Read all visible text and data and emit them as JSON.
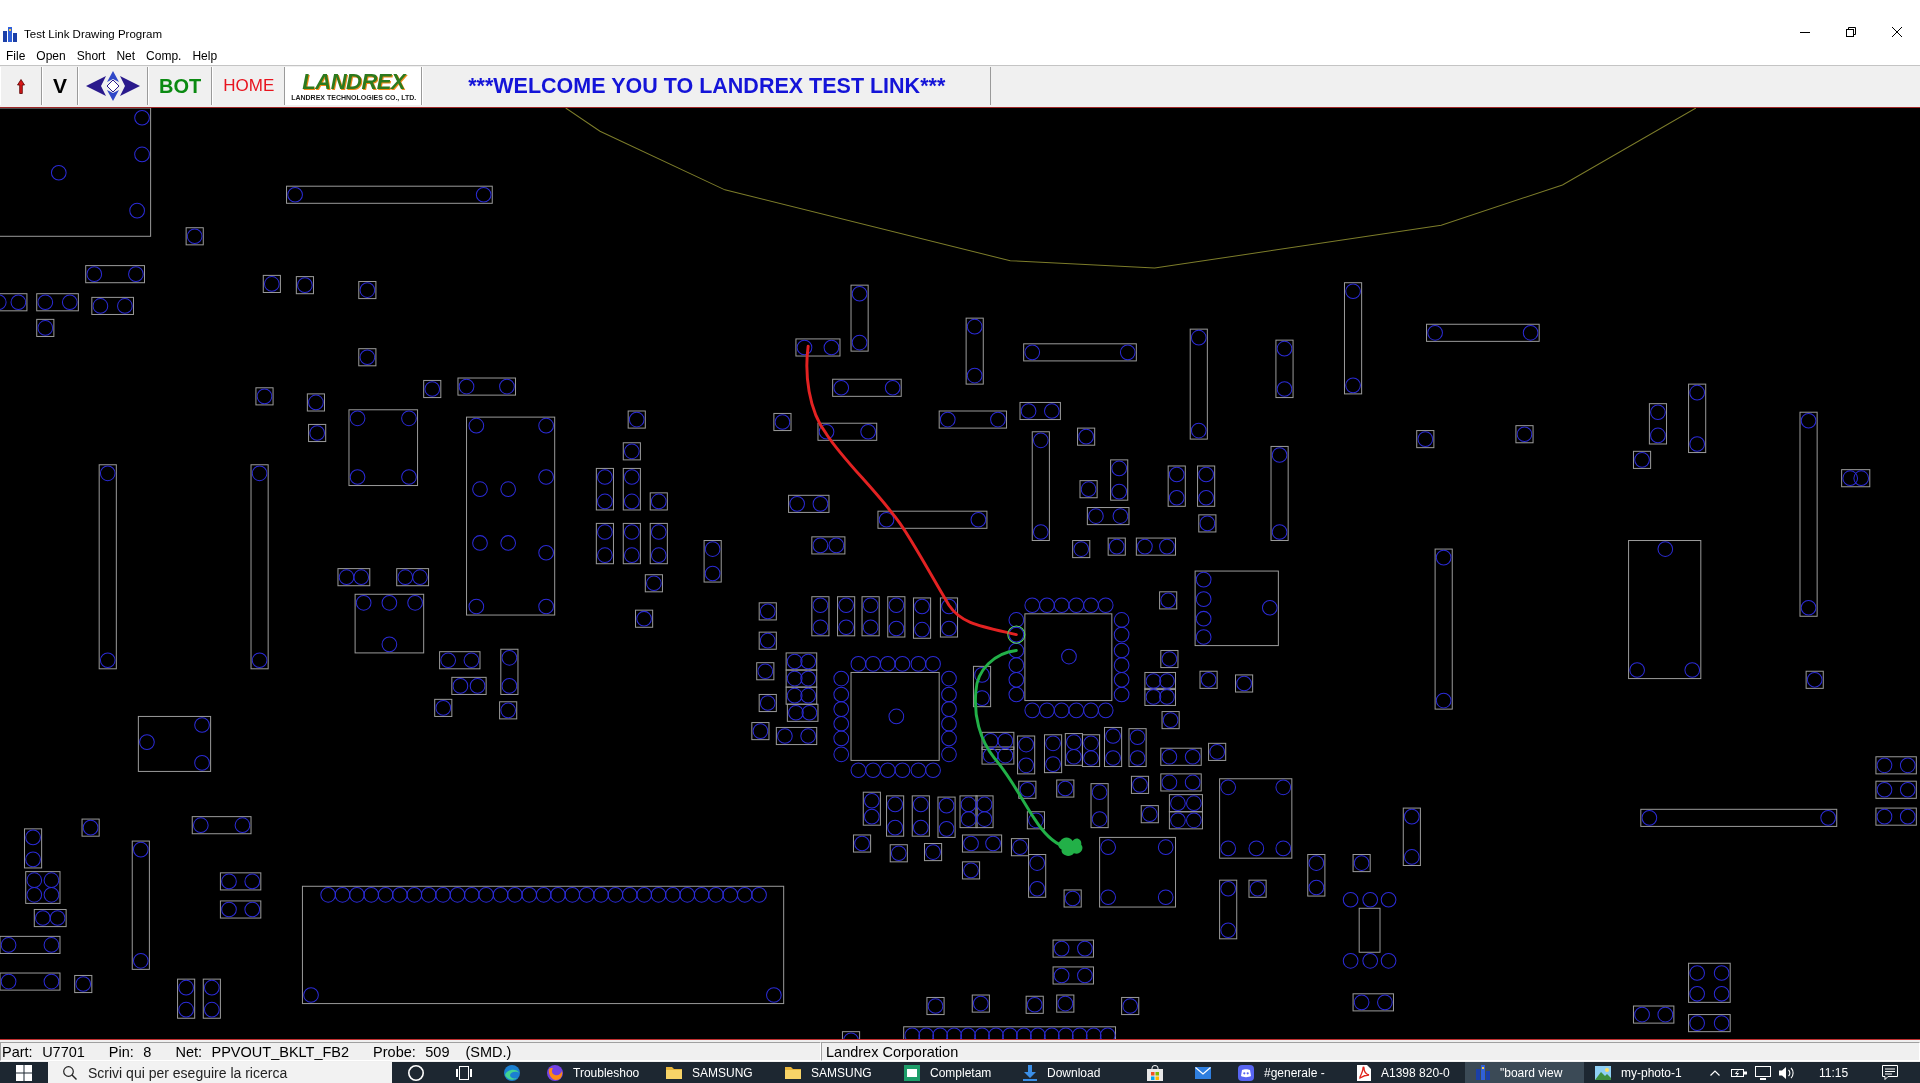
{
  "window": {
    "title": "Test Link Drawing Program"
  },
  "menu": [
    "File",
    "Open",
    "Short",
    "Net",
    "Comp.",
    "Help"
  ],
  "toolbar": {
    "buttons": [
      {
        "kind": "up-arrow"
      },
      {
        "kind": "text",
        "label": "V",
        "color": "#000000"
      },
      {
        "kind": "pan-arrows"
      },
      {
        "kind": "text",
        "label": "BOT",
        "color": "#0b8a12"
      },
      {
        "kind": "text",
        "label": "HOME",
        "color": "#e8141e"
      }
    ],
    "logo": {
      "wordmark": "LANDREX",
      "tagline": "LANDREX TECHNOLOGIES CO., LTD."
    },
    "banner": "***WELCOME YOU TO LANDREX TEST LINK***"
  },
  "status_bar": {
    "fields": [
      {
        "label": "Part:",
        "value": "U7701"
      },
      {
        "label": "Pin:",
        "value": "8"
      },
      {
        "label": "Net:",
        "value": "PPVOUT_BKLT_FB2"
      },
      {
        "label": "Probe:",
        "value": "509"
      }
    ],
    "package": "(SMD.)",
    "company": "Landrex Corporation"
  },
  "taskbar": {
    "search": {
      "placeholder": "Scrivi qui per eseguire la ricerca"
    },
    "items": [
      {
        "kind": "ring",
        "selected": false
      },
      {
        "kind": "task-view",
        "selected": false
      },
      {
        "kind": "swirl",
        "selected": false
      },
      {
        "kind": "globe",
        "label": "Troubleshoo",
        "selected": false
      },
      {
        "kind": "folder",
        "label": "SAMSUNG",
        "selected": false
      },
      {
        "kind": "folder",
        "label": "SAMSUNG",
        "selected": false
      },
      {
        "kind": "app",
        "label": "Completam",
        "selected": false
      },
      {
        "kind": "download",
        "label": "Download",
        "selected": false
      },
      {
        "kind": "bag",
        "selected": false
      },
      {
        "kind": "mail",
        "selected": false
      },
      {
        "kind": "chat",
        "label": "#generale -",
        "selected": false
      },
      {
        "kind": "document",
        "label": "A1398 820-0",
        "selected": false
      },
      {
        "kind": "building",
        "label": "\"board view",
        "selected": true
      },
      {
        "kind": "picture",
        "label": "my-photo-1",
        "selected": false
      }
    ],
    "clock": "11:15"
  }
}
